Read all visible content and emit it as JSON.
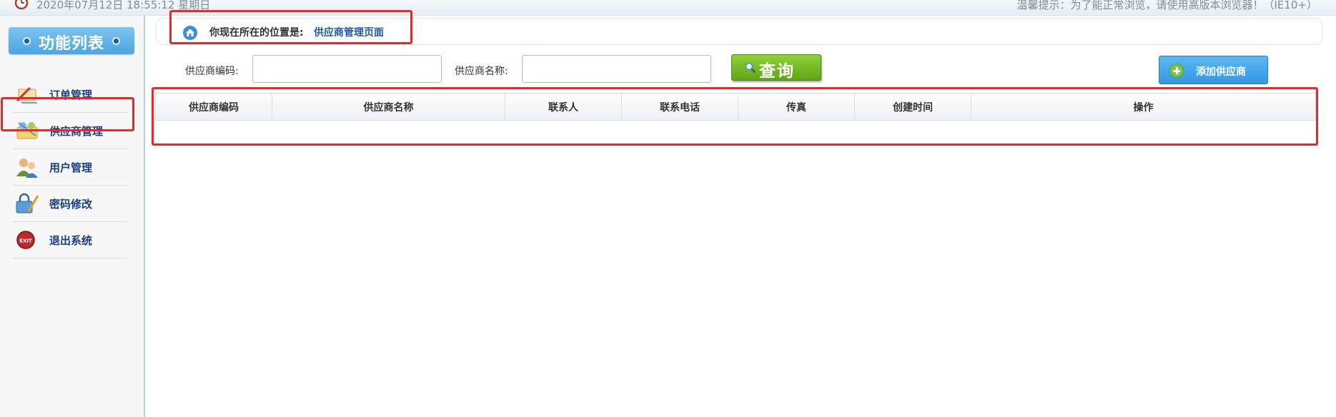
{
  "topbar": {
    "datetime": "2020年07月12日 18:55:12 星期日",
    "tip": "温馨提示：为了能正常浏览，请使用高版本浏览器！（IE10+）"
  },
  "sidebar": {
    "title": "功能列表",
    "items": [
      {
        "label": "订单管理",
        "icon": "order-icon"
      },
      {
        "label": "供应商管理",
        "icon": "provider-icon"
      },
      {
        "label": "用户管理",
        "icon": "users-icon"
      },
      {
        "label": "密码修改",
        "icon": "password-icon"
      },
      {
        "label": "退出系统",
        "icon": "exit-icon"
      }
    ]
  },
  "breadcrumb": {
    "lead": "你现在所在的位置是:",
    "location": "供应商管理页面"
  },
  "search": {
    "code_label": "供应商编码:",
    "code_value": "",
    "name_label": "供应商名称:",
    "name_value": "",
    "query_button": "查询",
    "add_button": "添加供应商"
  },
  "table": {
    "columns": [
      "供应商编码",
      "供应商名称",
      "联系人",
      "联系电话",
      "传真",
      "创建时间",
      "操作"
    ],
    "rows": []
  },
  "colors": {
    "accent_blue": "#4ba6e2",
    "query_green": "#6fba1f",
    "highlight_red": "#e8292a",
    "link_blue": "#1e5aa8"
  }
}
